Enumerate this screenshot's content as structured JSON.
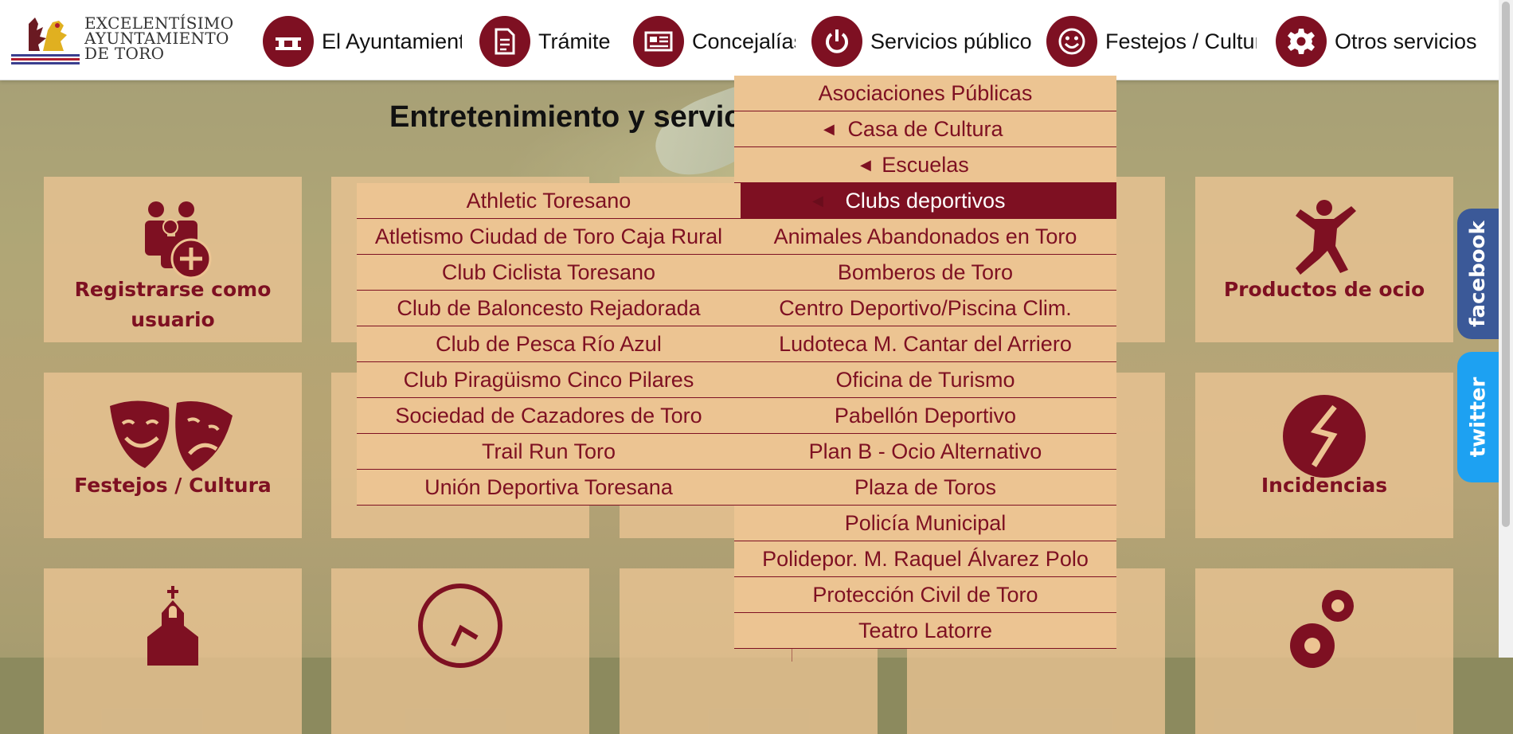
{
  "logo": {
    "lines": [
      "EXCELENTÍSIMO",
      "AYUNTAMIENTO",
      "DE TORO"
    ]
  },
  "nav": [
    {
      "label": "El Ayuntamiento",
      "icon": "townhall-icon"
    },
    {
      "label": "Trámite",
      "icon": "document-icon"
    },
    {
      "label": "Concejalías",
      "icon": "newspaper-icon"
    },
    {
      "label": "Servicios públicos",
      "icon": "power-icon"
    },
    {
      "label": "Festejos / Cultura",
      "icon": "smiley-icon"
    },
    {
      "label": "Otros servicios",
      "icon": "gear-icon"
    }
  ],
  "page_title": "Entretenimiento y servicios",
  "cards": [
    {
      "label": "Registrarse como usuario",
      "icon": "add-user-icon"
    },
    {
      "label": "Productos de ocio",
      "icon": "jumping-person-icon"
    },
    {
      "label": "Festejos / Cultura",
      "icon": "theater-masks-icon"
    },
    {
      "label": "Incidencias",
      "icon": "broken-circle-icon"
    }
  ],
  "social": {
    "facebook": "facebook",
    "twitter": "twitter"
  },
  "main_menu": [
    {
      "label": "Asociaciones Públicas"
    },
    {
      "label": "Casa de Cultura",
      "arrow": true
    },
    {
      "label": "Escuelas",
      "arrow": true
    },
    {
      "label": "Clubs deportivos",
      "arrow": true,
      "active": true
    },
    {
      "label": "Animales Abandonados en Toro"
    },
    {
      "label": "Bomberos de Toro"
    },
    {
      "label": "Centro Deportivo/Piscina Clim."
    },
    {
      "label": "Ludoteca M. Cantar del Arriero"
    },
    {
      "label": "Oficina de Turismo"
    },
    {
      "label": "Pabellón Deportivo"
    },
    {
      "label": "Plan B - Ocio Alternativo"
    },
    {
      "label": "Plaza de Toros"
    },
    {
      "label": "Policía Municipal"
    },
    {
      "label": "Polidepor. M. Raquel Álvarez Polo"
    },
    {
      "label": "Protección Civil de Toro"
    },
    {
      "label": "Teatro Latorre"
    }
  ],
  "sub_menu": [
    "Athletic Toresano",
    "Atletismo Ciudad de Toro Caja Rural",
    "Club Ciclista Toresano",
    "Club de Baloncesto Rejadorada",
    "Club de Pesca Río Azul",
    "Club Piragüismo Cinco Pilares",
    "Sociedad de Cazadores de Toro",
    "Trail Run Toro",
    "Unión Deportiva Toresana"
  ],
  "colors": {
    "brand": "#7e1022",
    "menu_bg": "#ecc492"
  }
}
